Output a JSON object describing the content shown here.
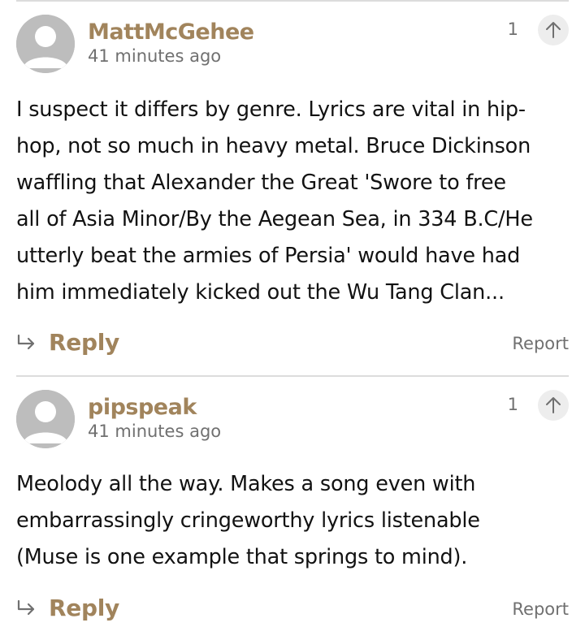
{
  "comments": [
    {
      "username": "MattMcGehee",
      "time": "41 minutes ago",
      "upvotes": "1",
      "body_lines": [
        "I suspect it differs by genre. Lyrics are vital in hip-",
        "hop, not so much in heavy metal. Bruce Dickinson",
        "waffling that Alexander the Great 'Swore to free",
        "all of Asia Minor/By the Aegean Sea, in 334 B.C/He",
        "utterly beat the armies of Persia' would have had",
        "him immediately kicked out the Wu Tang Clan..."
      ],
      "reply_label": "Reply",
      "report_label": "Report"
    },
    {
      "username": "pipspeak",
      "time": "41 minutes ago",
      "upvotes": "1",
      "body_lines": [
        "Meolody all the way. Makes a song even with",
        "embarrassingly cringeworthy lyrics listenable",
        "(Muse is one example that springs to mind)."
      ],
      "reply_label": "Reply",
      "report_label": "Report"
    }
  ],
  "icons": {
    "avatar": "user-avatar-icon",
    "upvote": "arrow-up-icon",
    "reply": "reply-arrow-icon"
  },
  "colors": {
    "accent": "#a1845c",
    "muted": "#707070",
    "divider": "#dcdcdc"
  }
}
